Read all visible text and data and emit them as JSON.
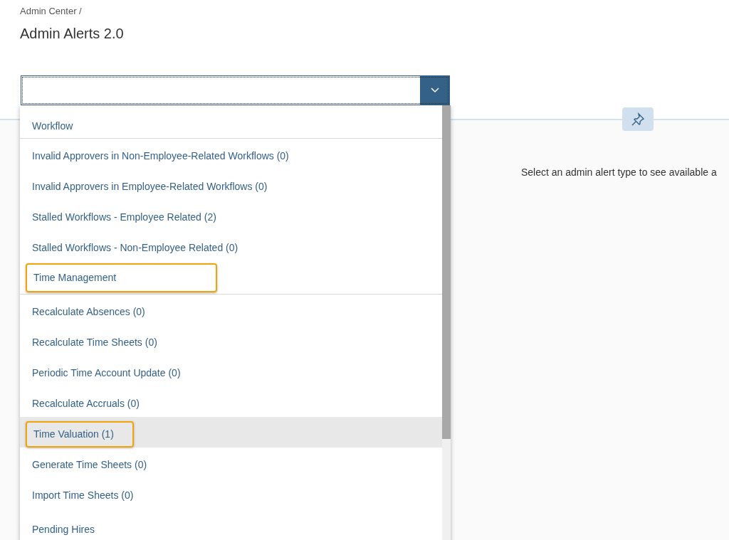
{
  "breadcrumb": "Admin Center /",
  "title": "Admin Alerts 2.0",
  "combobox": {
    "expanded": true
  },
  "message": "Select an admin alert type to see available a",
  "groups": [
    {
      "title": "Workflow",
      "annotated": false,
      "items": [
        {
          "label": "Invalid Approvers in Non-Employee-Related Workflows (0)",
          "hovered": false,
          "annotated": false
        },
        {
          "label": "Invalid Approvers in Employee-Related Workflows (0)",
          "hovered": false,
          "annotated": false
        },
        {
          "label": "Stalled Workflows - Employee Related (2)",
          "hovered": false,
          "annotated": false
        },
        {
          "label": "Stalled Workflows - Non-Employee Related (0)",
          "hovered": false,
          "annotated": false
        }
      ]
    },
    {
      "title": "Time Management",
      "annotated": true,
      "items": [
        {
          "label": "Recalculate Absences (0)",
          "hovered": false,
          "annotated": false
        },
        {
          "label": "Recalculate Time Sheets (0)",
          "hovered": false,
          "annotated": false
        },
        {
          "label": "Periodic Time Account Update (0)",
          "hovered": false,
          "annotated": false
        },
        {
          "label": "Recalculate Accruals (0)",
          "hovered": false,
          "annotated": false
        },
        {
          "label": "Time Valuation (1)",
          "hovered": true,
          "annotated": true
        },
        {
          "label": "Generate Time Sheets (0)",
          "hovered": false,
          "annotated": false
        },
        {
          "label": "Import Time Sheets (0)",
          "hovered": false,
          "annotated": false
        }
      ]
    },
    {
      "title": "Pending Hires",
      "annotated": false
    }
  ]
}
